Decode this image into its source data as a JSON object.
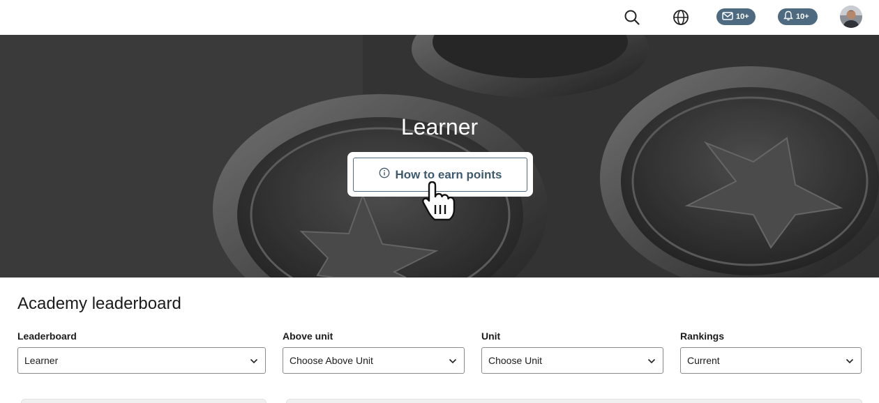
{
  "topbar": {
    "search_icon": "search-icon",
    "globe_icon": "globe-icon",
    "messages_badge": "10+",
    "notifications_badge": "10+",
    "accent": "#4d6a80"
  },
  "hero": {
    "title": "Learner",
    "earn_button_label": "How to earn points"
  },
  "leaderboard": {
    "title": "Academy leaderboard",
    "filters": [
      {
        "label": "Leaderboard",
        "value": "Learner"
      },
      {
        "label": "Above unit",
        "value": "Choose Above Unit"
      },
      {
        "label": "Unit",
        "value": "Choose Unit"
      },
      {
        "label": "Rankings",
        "value": "Current"
      }
    ]
  }
}
